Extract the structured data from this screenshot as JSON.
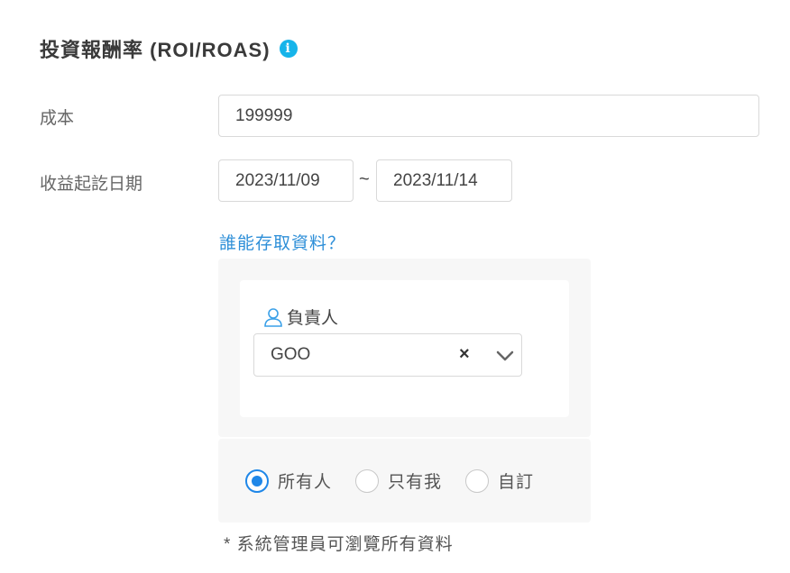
{
  "section": {
    "title": "投資報酬率 (ROI/ROAS)",
    "info_icon": "info-icon"
  },
  "cost": {
    "label": "成本",
    "value": "199999"
  },
  "date_range": {
    "label": "收益起訖日期",
    "start": "2023/11/09",
    "separator": "~",
    "end": "2023/11/14"
  },
  "access": {
    "link_text": "誰能存取資料？",
    "owner_label": "負責人",
    "owner_icon": "user-icon",
    "owner_value": "GOO",
    "clear_symbol": "×",
    "options": [
      {
        "label": "所有人",
        "checked": true
      },
      {
        "label": "只有我",
        "checked": false
      },
      {
        "label": "自訂",
        "checked": false
      }
    ],
    "note": "*  系統管理員可瀏覽所有資料"
  },
  "colors": {
    "accent": "#1f87e8",
    "link": "#2e8fd8",
    "info": "#16b4ea",
    "panel_bg": "#f7f7f7"
  }
}
